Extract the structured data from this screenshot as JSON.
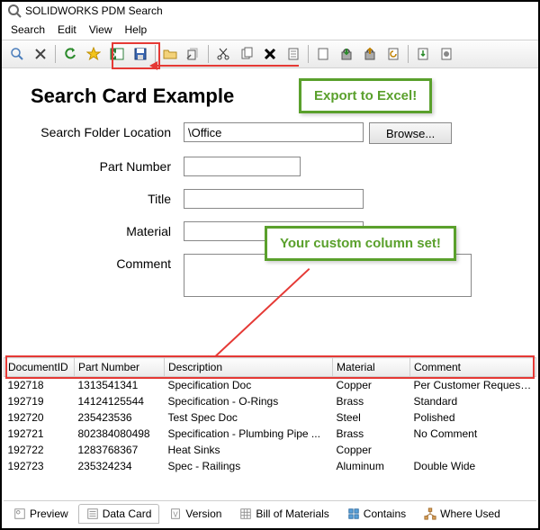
{
  "window": {
    "title": "SOLIDWORKS PDM Search"
  },
  "menu": {
    "items": [
      "Search",
      "Edit",
      "View",
      "Help"
    ]
  },
  "page_title": "Search Card Example",
  "callouts": {
    "excel": "Export to Excel!",
    "columns": "Your custom column set!"
  },
  "form": {
    "folder_label": "Search Folder Location",
    "folder_value": "\\Office",
    "browse": "Browse...",
    "part_label": "Part Number",
    "part_value": "",
    "title_label": "Title",
    "title_value": "",
    "material_label": "Material",
    "material_value": "",
    "comment_label": "Comment",
    "comment_value": ""
  },
  "columns": [
    "DocumentID",
    "Part Number",
    "Description",
    "Material",
    "Comment"
  ],
  "rows": [
    {
      "id": "192718",
      "pn": "1313541341",
      "desc": "Specification Doc",
      "mat": "Copper",
      "com": "Per Customer Request - Hollow"
    },
    {
      "id": "192719",
      "pn": "14124125544",
      "desc": "Specification - O-Rings",
      "mat": "Brass",
      "com": "Standard"
    },
    {
      "id": "192720",
      "pn": "235423536",
      "desc": "Test Spec Doc",
      "mat": "Steel",
      "com": "Polished"
    },
    {
      "id": "192721",
      "pn": "802384080498",
      "desc": "Specification - Plumbing Pipe ...",
      "mat": "Brass",
      "com": "No Comment"
    },
    {
      "id": "192722",
      "pn": "1283768367",
      "desc": "Heat Sinks",
      "mat": "Copper",
      "com": ""
    },
    {
      "id": "192723",
      "pn": "235324234",
      "desc": "Spec - Railings",
      "mat": "Aluminum",
      "com": "Double Wide"
    }
  ],
  "tabs": {
    "preview": "Preview",
    "datacard": "Data Card",
    "version": "Version",
    "bom": "Bill of Materials",
    "contains": "Contains",
    "whereused": "Where Used"
  }
}
